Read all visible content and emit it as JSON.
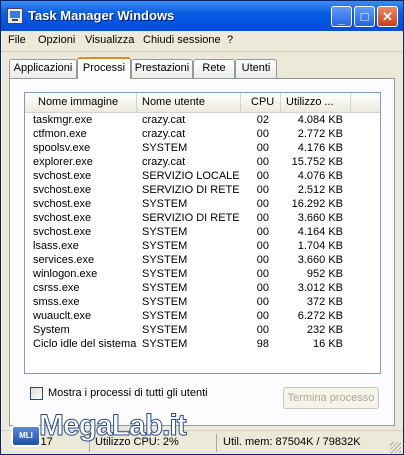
{
  "window": {
    "title": "Task Manager Windows"
  },
  "title_buttons": {
    "minimize": "_",
    "maximize": "□",
    "close": "✕"
  },
  "menu": [
    "File",
    "Opzioni",
    "Visualizza",
    "Chiudi sessione",
    "?"
  ],
  "tabs": [
    {
      "label": "Applicazioni",
      "active": false
    },
    {
      "label": "Processi",
      "active": true
    },
    {
      "label": "Prestazioni",
      "active": false
    },
    {
      "label": "Rete",
      "active": false
    },
    {
      "label": "Utenti",
      "active": false
    }
  ],
  "columns": [
    "Nome immagine",
    "Nome utente",
    "CPU",
    "Utilizzo ..."
  ],
  "processes": [
    {
      "name": "taskmgr.exe",
      "user": "crazy.cat",
      "cpu": "02",
      "mem": "4.084 KB"
    },
    {
      "name": "ctfmon.exe",
      "user": "crazy.cat",
      "cpu": "00",
      "mem": "2.772 KB"
    },
    {
      "name": "spoolsv.exe",
      "user": "SYSTEM",
      "cpu": "00",
      "mem": "4.176 KB"
    },
    {
      "name": "explorer.exe",
      "user": "crazy.cat",
      "cpu": "00",
      "mem": "15.752 KB"
    },
    {
      "name": "svchost.exe",
      "user": "SERVIZIO LOCALE",
      "cpu": "00",
      "mem": "4.076 KB"
    },
    {
      "name": "svchost.exe",
      "user": "SERVIZIO DI RETE",
      "cpu": "00",
      "mem": "2.512 KB"
    },
    {
      "name": "svchost.exe",
      "user": "SYSTEM",
      "cpu": "00",
      "mem": "16.292 KB"
    },
    {
      "name": "svchost.exe",
      "user": "SERVIZIO DI RETE",
      "cpu": "00",
      "mem": "3.660 KB"
    },
    {
      "name": "svchost.exe",
      "user": "SYSTEM",
      "cpu": "00",
      "mem": "4.164 KB"
    },
    {
      "name": "lsass.exe",
      "user": "SYSTEM",
      "cpu": "00",
      "mem": "1.704 KB"
    },
    {
      "name": "services.exe",
      "user": "SYSTEM",
      "cpu": "00",
      "mem": "3.660 KB"
    },
    {
      "name": "winlogon.exe",
      "user": "SYSTEM",
      "cpu": "00",
      "mem": "952 KB"
    },
    {
      "name": "csrss.exe",
      "user": "SYSTEM",
      "cpu": "00",
      "mem": "3.012 KB"
    },
    {
      "name": "smss.exe",
      "user": "SYSTEM",
      "cpu": "00",
      "mem": "372 KB"
    },
    {
      "name": "wuauclt.exe",
      "user": "SYSTEM",
      "cpu": "00",
      "mem": "6.272 KB"
    },
    {
      "name": "System",
      "user": "SYSTEM",
      "cpu": "00",
      "mem": "232 KB"
    },
    {
      "name": "Ciclo idle del sistema",
      "user": "SYSTEM",
      "cpu": "98",
      "mem": "16 KB"
    }
  ],
  "show_all_label": "Mostra i processi di tutti gli utenti",
  "show_all_checked": false,
  "end_process_label": "Termina processo",
  "status": {
    "processes": "ssi: 17",
    "cpu": "Utilizzo CPU: 2%",
    "memory": "Util. mem: 87504K / 79832K"
  },
  "watermark": {
    "text": "MegaLab.it",
    "badge": "MLI"
  },
  "colors": {
    "titlebar": "#0054e3",
    "active_tab_accent": "#e68b2c",
    "window_bg": "#ece9d8"
  }
}
